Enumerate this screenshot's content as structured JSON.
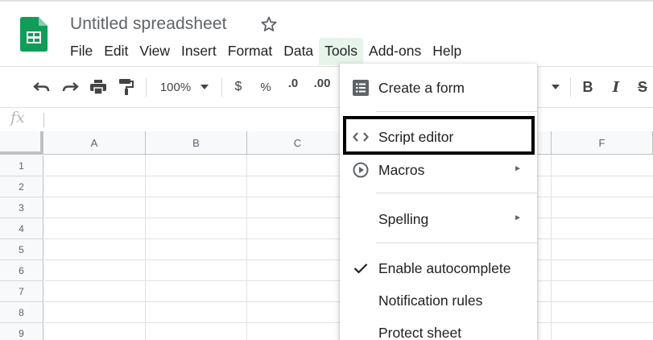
{
  "header": {
    "doc_title": "Untitled spreadsheet"
  },
  "menubar": {
    "items": [
      "File",
      "Edit",
      "View",
      "Insert",
      "Format",
      "Data",
      "Tools",
      "Add-ons",
      "Help"
    ],
    "active": "Tools"
  },
  "toolbar": {
    "zoom": "100%",
    "currency": "$",
    "percent": "%",
    "decrease_decimal": ".0",
    "increase_decimal": ".00",
    "bold": "B",
    "italic": "I",
    "strikethrough": "S"
  },
  "formula_bar": {
    "fx_label": "fx",
    "value": ""
  },
  "grid": {
    "columns": [
      "A",
      "B",
      "C",
      "F"
    ],
    "rows": [
      "1",
      "2",
      "3",
      "4",
      "5",
      "6",
      "7",
      "8",
      "9"
    ]
  },
  "tools_menu": {
    "items": [
      {
        "label": "Create a form",
        "icon": "form-icon",
        "submenu": false
      },
      {
        "label": "Script editor",
        "icon": "code-icon",
        "submenu": false,
        "highlighted": true
      },
      {
        "label": "Macros",
        "icon": "play-circle-icon",
        "submenu": true
      },
      {
        "label": "Spelling",
        "icon": "",
        "submenu": true
      },
      {
        "label": "Enable autocomplete",
        "icon": "check-icon",
        "submenu": false,
        "checked": true
      },
      {
        "label": "Notification rules",
        "icon": "",
        "submenu": false
      },
      {
        "label": "Protect sheet",
        "icon": "",
        "submenu": false
      }
    ],
    "submenu_arrow": "►"
  },
  "colors": {
    "sheets_green": "#0f9d58",
    "active_menu_bg": "#e6f4ea",
    "header_bg": "#f8f9fa",
    "highlight_border": "#000000"
  }
}
